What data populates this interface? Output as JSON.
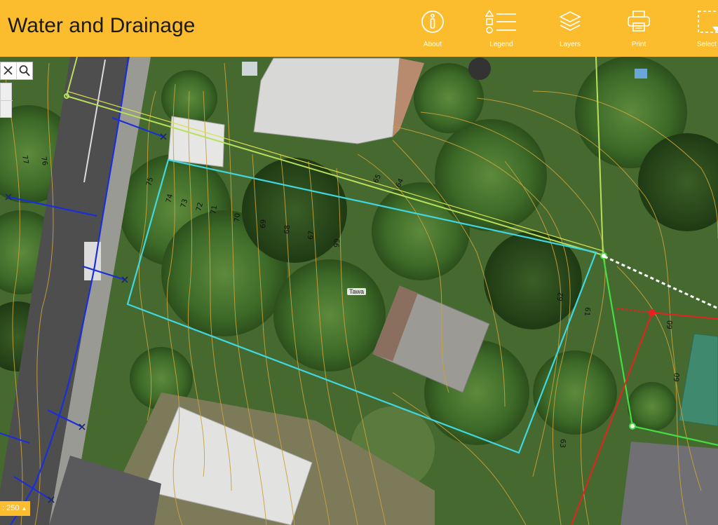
{
  "app": {
    "title": "Water and Drainage"
  },
  "toolbar": {
    "about": "About",
    "legend": "Legend",
    "layers": "Layers",
    "print": "Print",
    "select": "Select"
  },
  "search": {
    "clear_icon": "close-icon",
    "search_icon": "search-icon"
  },
  "scale": {
    "label": ": 250"
  },
  "map": {
    "parcel_label": "Tawa",
    "contour_labels": [
      "77",
      "76",
      "75",
      "74",
      "73",
      "72",
      "71",
      "70",
      "69",
      "68",
      "67",
      "66",
      "65",
      "64",
      "62",
      "61",
      "60",
      "60",
      "63"
    ],
    "colors": {
      "parcel": "#40d8e0",
      "stormwater": "#1a2fd8",
      "wastewater": "#e82020",
      "watermain": "#b8e05a",
      "service": "#44dd44",
      "contour": "#c9a23a",
      "accent": "#fbbd2e"
    }
  }
}
